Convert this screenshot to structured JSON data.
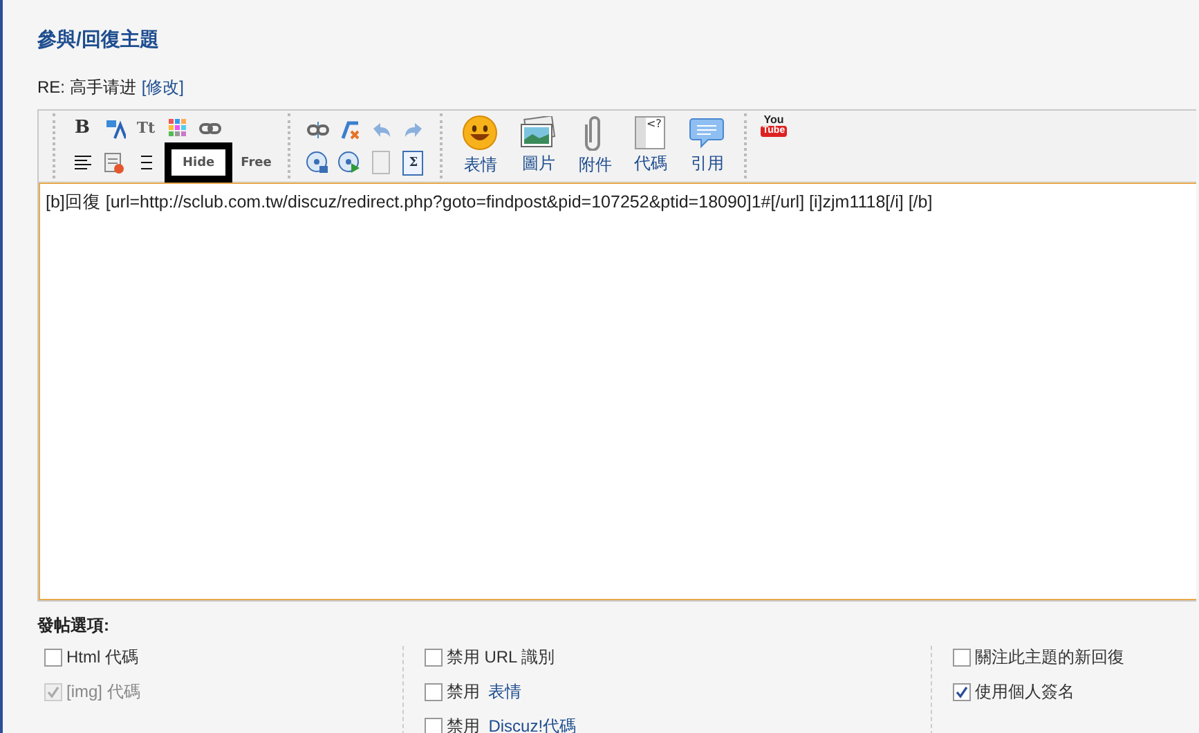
{
  "heading": "參與/回復主題",
  "subject": {
    "text": "RE: 高手请进",
    "link": "[修改]"
  },
  "toolbar": {
    "small_groups": [
      [
        [
          {
            "kind": "bold",
            "glyph": "B"
          },
          {
            "kind": "color"
          },
          {
            "kind": "size",
            "glyph": "Tt"
          },
          {
            "kind": "grid"
          },
          {
            "kind": "link"
          }
        ],
        [
          {
            "kind": "align"
          },
          {
            "kind": "remove-list"
          },
          {
            "kind": "list"
          },
          {
            "kind": "text-tag",
            "glyph": "Hide",
            "highlighted": true
          },
          {
            "kind": "text-tag",
            "glyph": "Free",
            "highlighted": false
          }
        ]
      ],
      [
        [
          {
            "kind": "unlink"
          },
          {
            "kind": "clear-format"
          },
          {
            "kind": "undo"
          },
          {
            "kind": "redo"
          }
        ],
        [
          {
            "kind": "media"
          },
          {
            "kind": "media-play"
          },
          {
            "kind": "page"
          },
          {
            "kind": "sigma",
            "glyph": "Σ"
          }
        ]
      ]
    ],
    "big_buttons": [
      {
        "kind": "smiley",
        "label": "表情"
      },
      {
        "kind": "image",
        "label": "圖片"
      },
      {
        "kind": "clip",
        "label": "附件"
      },
      {
        "kind": "code",
        "label": "代碼",
        "glyph": "<?"
      },
      {
        "kind": "quote",
        "label": "引用"
      }
    ],
    "video": {
      "top": "You",
      "bottom": "Tube"
    }
  },
  "message": "[b]回復 [url=http://sclub.com.tw/discuz/redirect.php?goto=findpost&pid=107252&ptid=18090]1#[/url] [i]zjm1118[/i] [/b]",
  "options_title": "發帖選項:",
  "option_columns": [
    [
      {
        "label": "Html 代碼",
        "checked": false,
        "disabled": false
      },
      {
        "label": "[img] 代碼",
        "checked": true,
        "disabled": true
      }
    ],
    [
      {
        "label": "禁用 URL 識別",
        "checked": false,
        "disabled": false
      },
      {
        "label": "禁用 ",
        "link": "表情",
        "checked": false,
        "disabled": false
      },
      {
        "label": "禁用 ",
        "link": "Discuz!代碼",
        "checked": false,
        "disabled": false
      }
    ],
    [
      {
        "label": "關注此主題的新回復",
        "checked": false,
        "disabled": false
      },
      {
        "label": "使用個人簽名",
        "checked": true,
        "disabled": false
      }
    ]
  ]
}
